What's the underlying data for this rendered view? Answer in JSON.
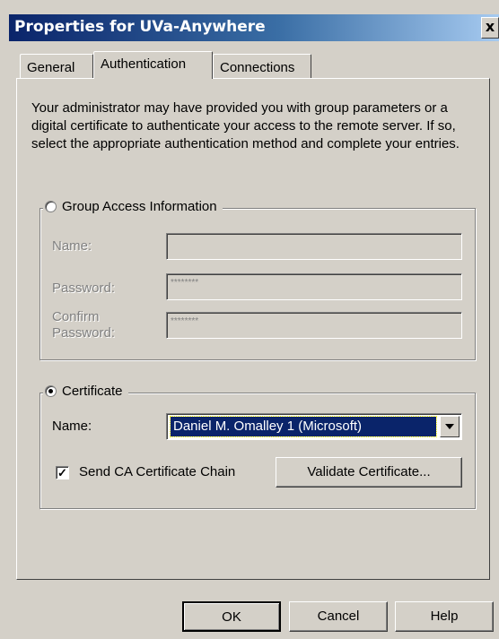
{
  "window": {
    "title": "Properties for UVa-Anywhere",
    "close_glyph": "x"
  },
  "tabs": [
    {
      "label": "General",
      "active": false
    },
    {
      "label": "Authentication",
      "active": true
    },
    {
      "label": "Connections",
      "active": false
    }
  ],
  "intro_text": "Your administrator may have provided you with group parameters or a digital certificate to authenticate your access to the remote server.  If so, select the appropriate authentication method and complete your entries.",
  "group_access": {
    "legend": "Group Access Information",
    "selected": false,
    "name_label": "Name:",
    "name_value": "",
    "password_label": "Password:",
    "password_value": "********",
    "confirm_label_line1": "Confirm",
    "confirm_label_line2": "Password:",
    "confirm_value": "********"
  },
  "certificate": {
    "legend": "Certificate",
    "selected": true,
    "name_label": "Name:",
    "name_value": "Daniel M. Omalley 1 (Microsoft)",
    "send_chain_label": "Send CA Certificate Chain",
    "send_chain_checked": true,
    "validate_label": "Validate Certificate..."
  },
  "buttons": {
    "ok": "OK",
    "cancel": "Cancel",
    "help": "Help"
  }
}
